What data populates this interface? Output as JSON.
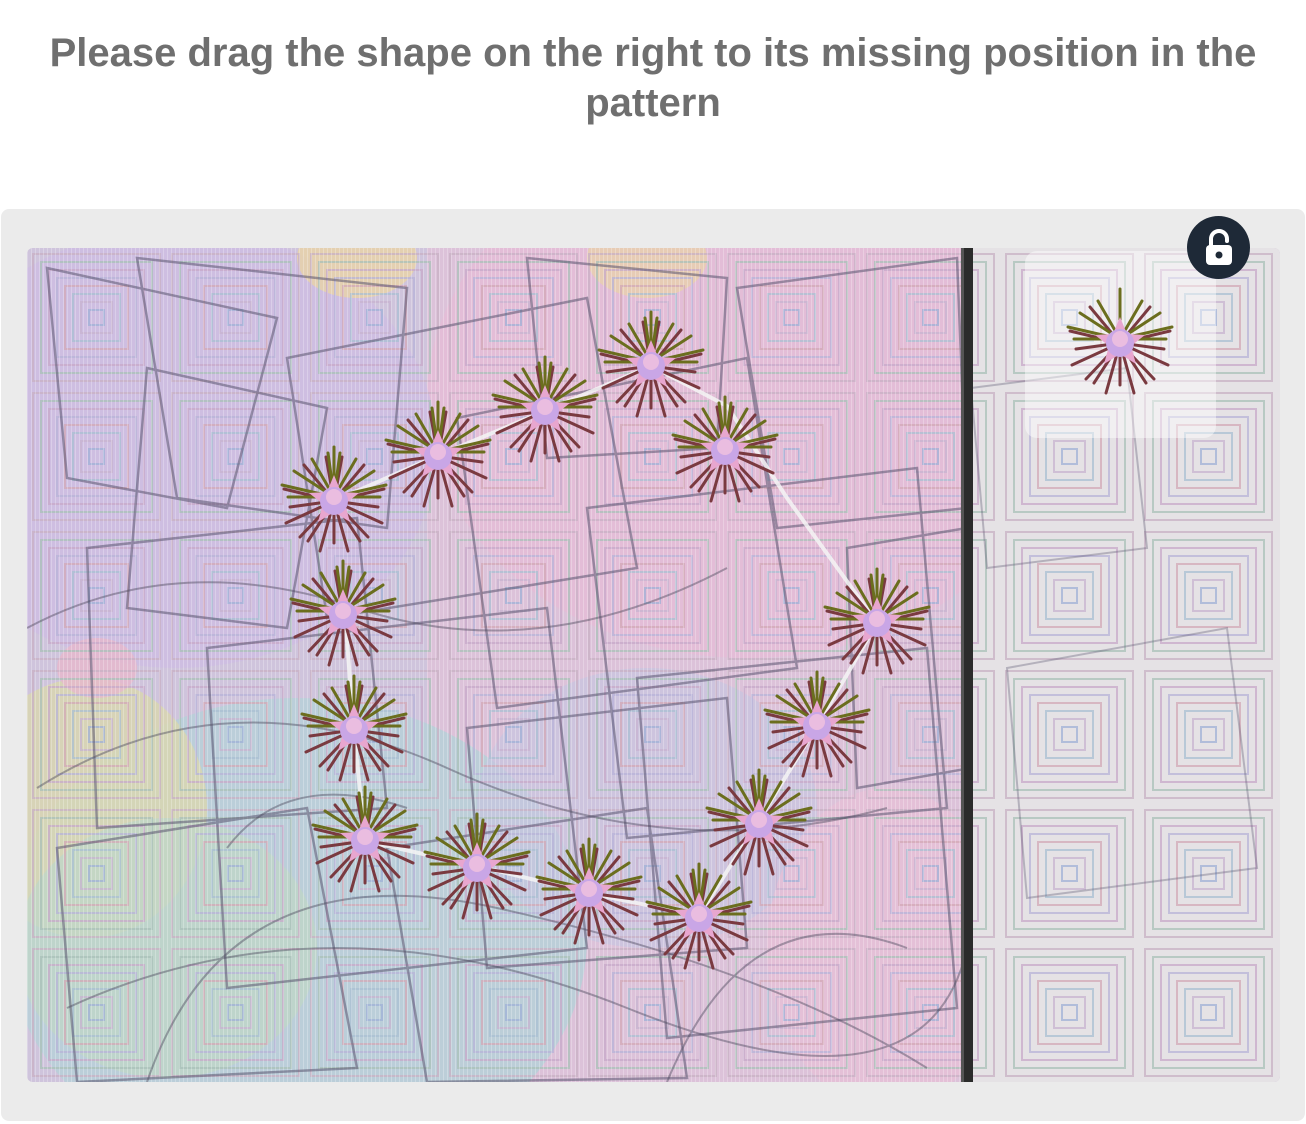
{
  "instruction": "Please drag the shape on the right to its missing position in the pattern",
  "icons": {
    "lock": "lock-icon"
  },
  "colors": {
    "instruction_text": "#6f6f6f",
    "panel_bg": "#ebebeb",
    "lock_button_bg": "#1e2937",
    "flower_outer": "#7a3a40",
    "flower_top": "#6b6e1e",
    "flower_center": "#c9a6e6"
  }
}
